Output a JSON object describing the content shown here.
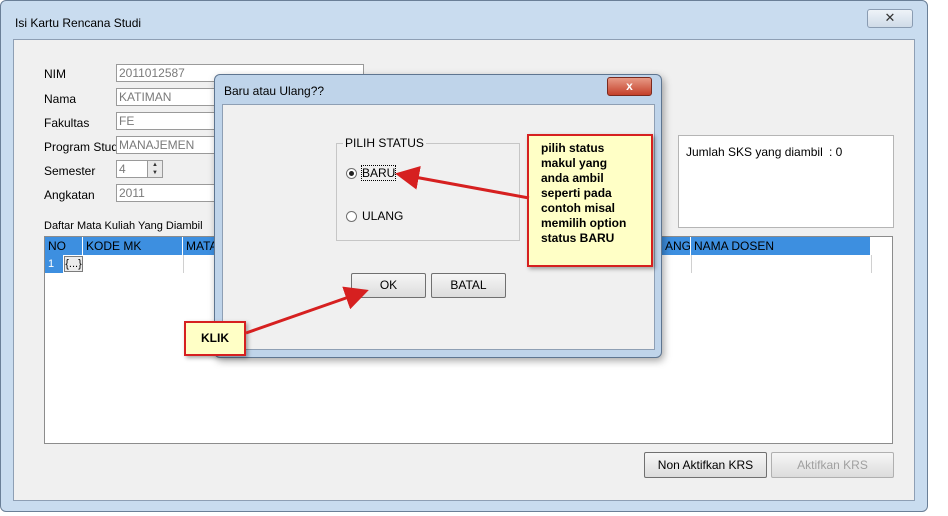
{
  "main_window": {
    "title": "Isi Kartu Rencana Studi",
    "close_glyph": "✕"
  },
  "form": {
    "nim": {
      "label": "NIM",
      "value": "2011012587"
    },
    "nama": {
      "label": "Nama",
      "value": "KATIMAN"
    },
    "fakultas": {
      "label": "Fakultas",
      "value": "FE"
    },
    "program_studi": {
      "label": "Program Studi",
      "value": "MANAJEMEN"
    },
    "semester": {
      "label": "Semester",
      "value": "4"
    },
    "angkatan": {
      "label": "Angkatan",
      "value": "2011"
    }
  },
  "sks": {
    "label": "Jumlah SKS yang diambil",
    "value": ":  0"
  },
  "grid": {
    "title": "Daftar Mata Kuliah Yang Diambil",
    "columns": [
      "NO",
      "KODE MK",
      "MATA",
      "ANG",
      "NAMA DOSEN"
    ],
    "rows": [
      {
        "no": "1",
        "button": "{...}"
      }
    ]
  },
  "buttons": {
    "non_aktifkan": "Non Aktifkan KRS",
    "aktifkan": "Aktifkan KRS"
  },
  "dialog": {
    "title": "Baru atau Ulang??",
    "close_glyph": "x",
    "group_title": "PILIH STATUS",
    "options": [
      {
        "label": "BARU",
        "selected": true
      },
      {
        "label": "ULANG",
        "selected": false
      }
    ],
    "ok": "OK",
    "cancel": "BATAL"
  },
  "annotations": {
    "status_lines": [
      "pilih status",
      "makul yang",
      "anda ambil",
      "seperti pada",
      "contoh misal",
      "memilih option",
      "status BARU"
    ],
    "klik": "KLIK",
    "color": "#d62020"
  }
}
